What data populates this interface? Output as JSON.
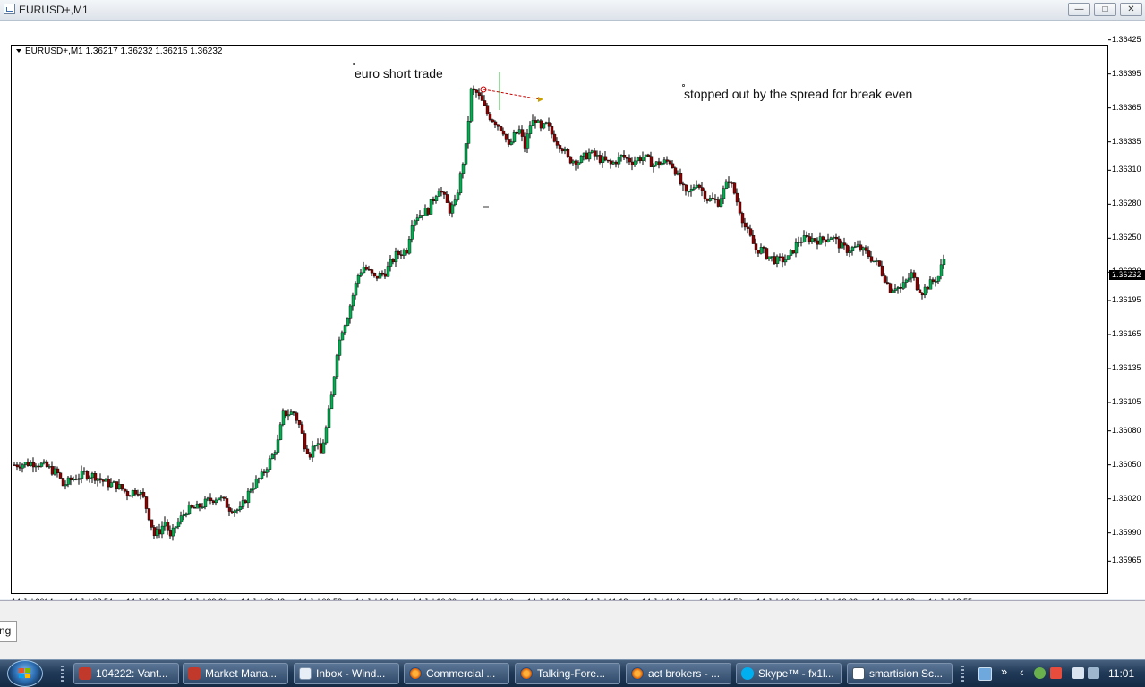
{
  "window": {
    "title": "EURUSD+,M1",
    "min_glyph": "—",
    "max_glyph": "□",
    "close_glyph": "✕"
  },
  "chart_header": "EURUSD+,M1  1.36217 1.36232 1.36215 1.36232",
  "annotations": {
    "trade_label": "euro short trade",
    "stop_label": "stopped out by the spread for break even"
  },
  "current_price": "1.36232",
  "chart_data": {
    "type": "candlestick",
    "symbol": "EURUSD+",
    "timeframe": "M1",
    "ohlc_last": {
      "open": 1.36217,
      "high": 1.36232,
      "low": 1.36215,
      "close": 1.36232
    },
    "ylim": [
      1.35955,
      1.36435
    ],
    "y_ticks": [
      "1.36425",
      "1.36395",
      "1.36365",
      "1.36335",
      "1.36310",
      "1.36280",
      "1.36250",
      "1.36220",
      "1.36195",
      "1.36165",
      "1.36135",
      "1.36105",
      "1.36080",
      "1.36050",
      "1.36020",
      "1.35990",
      "1.35965"
    ],
    "x_ticks": [
      "14 Jul 2014",
      "14 Jul 08:54",
      "14 Jul 09:10",
      "14 Jul 09:26",
      "14 Jul 09:42",
      "14 Jul 09:58",
      "14 Jul 10:14",
      "14 Jul 10:30",
      "14 Jul 10:46",
      "14 Jul 11:02",
      "14 Jul 11:18",
      "14 Jul 11:34",
      "14 Jul 11:50",
      "14 Jul 12:06",
      "14 Jul 12:22",
      "14 Jul 12:38",
      "14 Jul 12:55"
    ],
    "close_path": [
      [
        0,
        1.3605
      ],
      [
        8,
        1.36052
      ],
      [
        12,
        1.36048
      ],
      [
        16,
        1.36042
      ],
      [
        18,
        1.36032
      ],
      [
        22,
        1.36038
      ],
      [
        26,
        1.36042
      ],
      [
        30,
        1.3604
      ],
      [
        34,
        1.36034
      ],
      [
        38,
        1.36032
      ],
      [
        42,
        1.36025
      ],
      [
        46,
        1.36028
      ],
      [
        48,
        1.3602
      ],
      [
        50,
        1.36005
      ],
      [
        52,
        1.35988
      ],
      [
        54,
        1.35992
      ],
      [
        56,
        1.36
      ],
      [
        58,
        1.35985
      ],
      [
        60,
        1.35996
      ],
      [
        64,
        1.3601
      ],
      [
        68,
        1.36012
      ],
      [
        72,
        1.36018
      ],
      [
        76,
        1.36022
      ],
      [
        80,
        1.36012
      ],
      [
        84,
        1.3601
      ],
      [
        88,
        1.3603
      ],
      [
        92,
        1.3604
      ],
      [
        96,
        1.36058
      ],
      [
        98,
        1.3607
      ],
      [
        100,
        1.36095
      ],
      [
        104,
        1.36096
      ],
      [
        106,
        1.36085
      ],
      [
        108,
        1.36068
      ],
      [
        110,
        1.3606
      ],
      [
        112,
        1.3607
      ],
      [
        114,
        1.3606
      ],
      [
        116,
        1.36082
      ],
      [
        118,
        1.3611
      ],
      [
        120,
        1.3615
      ],
      [
        122,
        1.3617
      ],
      [
        124,
        1.36182
      ],
      [
        126,
        1.362
      ],
      [
        128,
        1.36218
      ],
      [
        130,
        1.36225
      ],
      [
        134,
        1.36215
      ],
      [
        138,
        1.3622
      ],
      [
        142,
        1.36235
      ],
      [
        146,
        1.3624
      ],
      [
        148,
        1.36265
      ],
      [
        150,
        1.3627
      ],
      [
        154,
        1.36275
      ],
      [
        158,
        1.36295
      ],
      [
        160,
        1.36285
      ],
      [
        162,
        1.36275
      ],
      [
        164,
        1.3628
      ],
      [
        166,
        1.36305
      ],
      [
        168,
        1.3633
      ],
      [
        170,
        1.3638
      ],
      [
        172,
        1.36378
      ],
      [
        174,
        1.3637
      ],
      [
        176,
        1.3636
      ],
      [
        178,
        1.36355
      ],
      [
        180,
        1.3635
      ],
      [
        182,
        1.36345
      ],
      [
        184,
        1.3633
      ],
      [
        186,
        1.3634
      ],
      [
        188,
        1.36345
      ],
      [
        190,
        1.3633
      ],
      [
        192,
        1.3635
      ],
      [
        194,
        1.36355
      ],
      [
        196,
        1.36345
      ],
      [
        198,
        1.3635
      ],
      [
        200,
        1.36342
      ],
      [
        202,
        1.36335
      ],
      [
        204,
        1.3633
      ],
      [
        206,
        1.3632
      ],
      [
        210,
        1.36318
      ],
      [
        214,
        1.36325
      ],
      [
        218,
        1.3632
      ],
      [
        222,
        1.36315
      ],
      [
        226,
        1.36322
      ],
      [
        230,
        1.36318
      ],
      [
        234,
        1.36322
      ],
      [
        238,
        1.36315
      ],
      [
        240,
        1.36316
      ],
      [
        244,
        1.36318
      ],
      [
        246,
        1.3631
      ],
      [
        248,
        1.36298
      ],
      [
        250,
        1.36288
      ],
      [
        252,
        1.36292
      ],
      [
        254,
        1.363
      ],
      [
        256,
        1.36292
      ],
      [
        258,
        1.36285
      ],
      [
        262,
        1.36282
      ],
      [
        264,
        1.36292
      ],
      [
        266,
        1.36302
      ],
      [
        268,
        1.3629
      ],
      [
        270,
        1.36275
      ],
      [
        272,
        1.3626
      ],
      [
        274,
        1.3625
      ],
      [
        276,
        1.3624
      ],
      [
        278,
        1.3624
      ],
      [
        280,
        1.36235
      ],
      [
        284,
        1.3623
      ],
      [
        288,
        1.36232
      ],
      [
        292,
        1.36248
      ],
      [
        296,
        1.3625
      ],
      [
        300,
        1.36248
      ],
      [
        304,
        1.36252
      ],
      [
        308,
        1.36242
      ],
      [
        310,
        1.3624
      ],
      [
        314,
        1.36242
      ],
      [
        318,
        1.36235
      ],
      [
        322,
        1.36225
      ],
      [
        324,
        1.36215
      ],
      [
        326,
        1.36205
      ],
      [
        328,
        1.36208
      ],
      [
        330,
        1.36205
      ],
      [
        332,
        1.36212
      ],
      [
        334,
        1.36218
      ],
      [
        336,
        1.36208
      ],
      [
        338,
        1.36203
      ],
      [
        340,
        1.36208
      ],
      [
        342,
        1.36212
      ],
      [
        344,
        1.36217
      ],
      [
        346,
        1.36232
      ]
    ],
    "candle_count": 347
  },
  "taskbar": {
    "items": [
      {
        "label": "104222: Vant..."
      },
      {
        "label": "Market Mana..."
      },
      {
        "label": "Inbox - Wind..."
      },
      {
        "label": "Commercial ..."
      },
      {
        "label": "Talking-Fore..."
      },
      {
        "label": "act brokers - ..."
      },
      {
        "label": "Skype™ - fx1l..."
      },
      {
        "label": "smartision Sc..."
      }
    ],
    "clock": "11:01",
    "overflow_glyph": "»"
  },
  "bottom_tab": "ng",
  "colors": {
    "bull": "#00b050",
    "bear": "#8b0000",
    "stop_line": "#cc0000",
    "arrow": "#c8a000"
  }
}
